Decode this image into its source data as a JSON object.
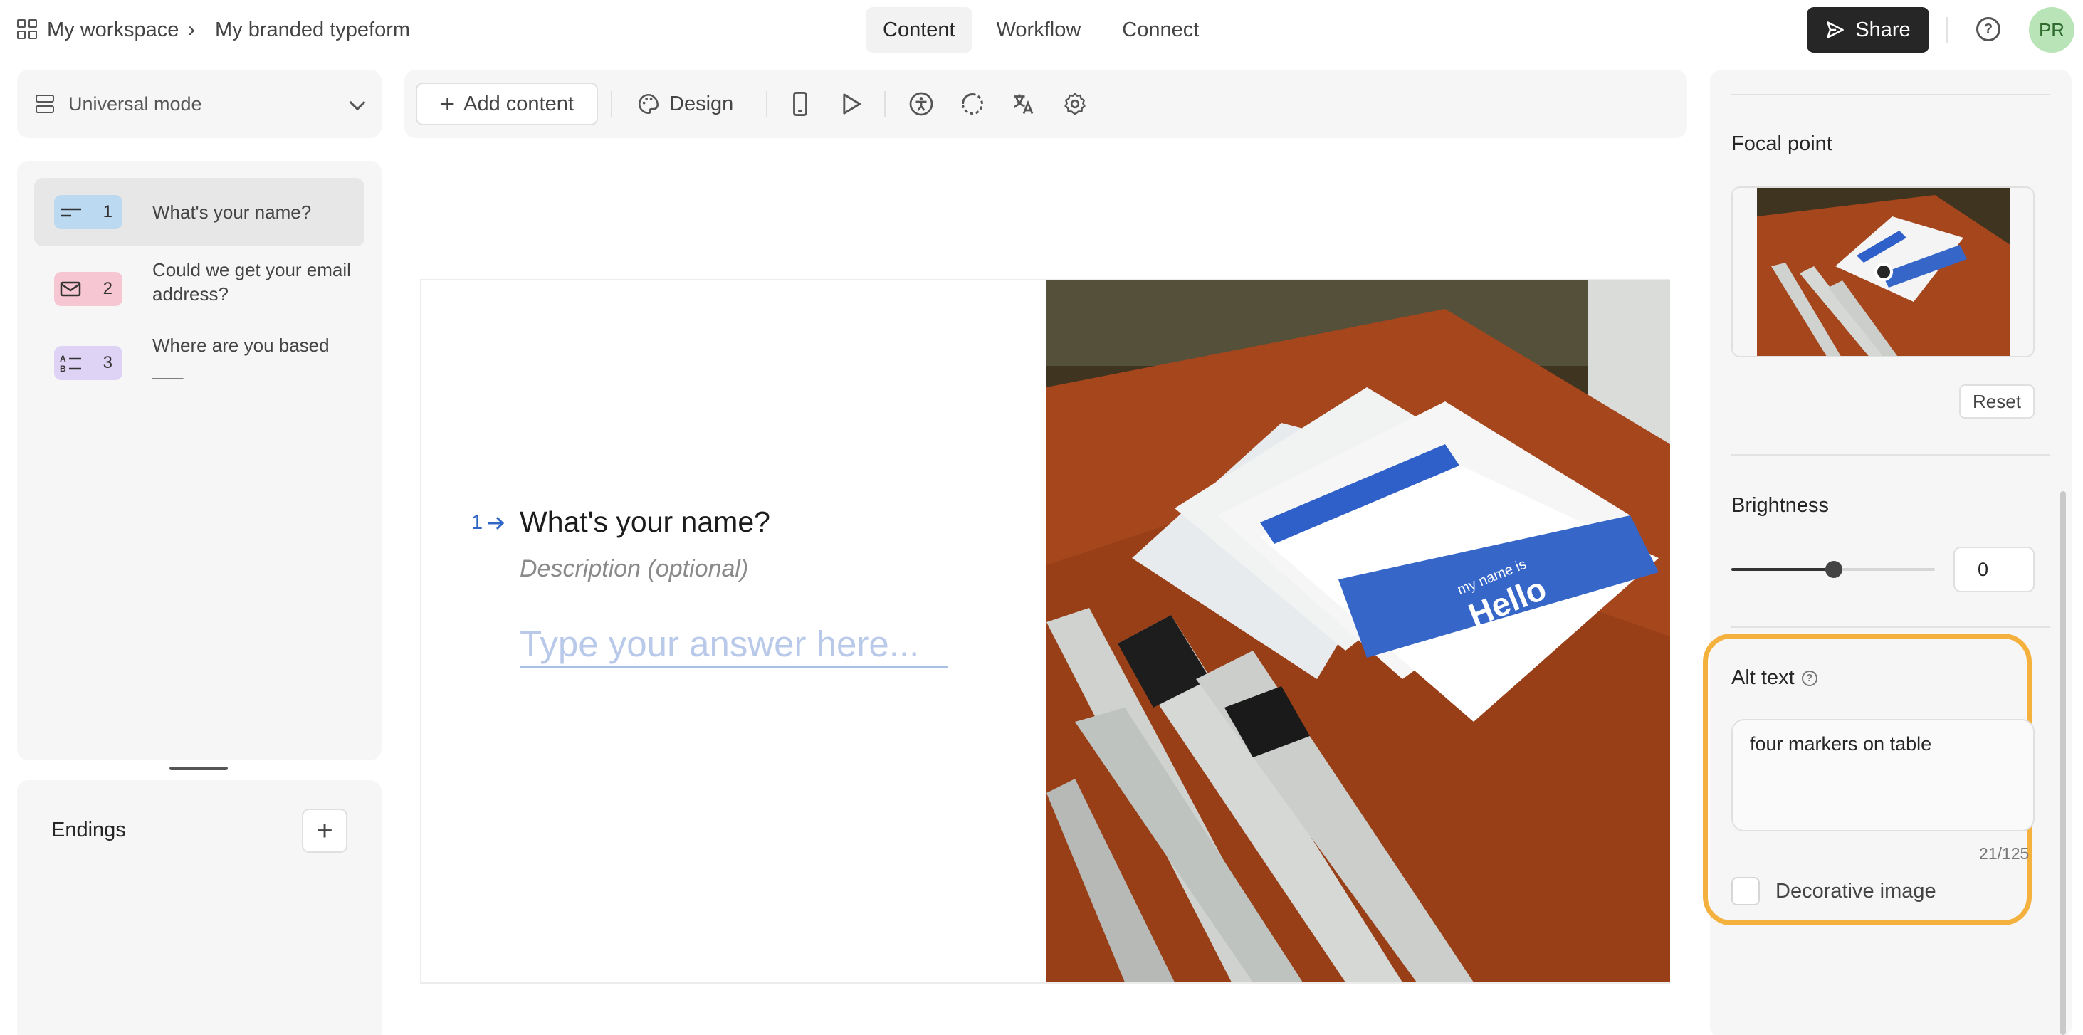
{
  "header": {
    "breadcrumb_workspace": "My workspace",
    "breadcrumb_separator": "›",
    "breadcrumb_form": "My branded typeform",
    "tabs": [
      {
        "label": "Content",
        "active": true
      },
      {
        "label": "Workflow",
        "active": false
      },
      {
        "label": "Connect",
        "active": false
      }
    ],
    "share_label": "Share",
    "help_icon": "help-circle-icon",
    "avatar_initials": "PR"
  },
  "sidebar": {
    "mode_label": "Universal mode",
    "questions": [
      {
        "number": "1",
        "text": "What's your name?",
        "icon": "short-text-icon",
        "badge_color": "#bcd9f2",
        "active": true
      },
      {
        "number": "2",
        "text": "Could we get your email address?",
        "icon": "email-icon",
        "badge_color": "#f6c6d3",
        "active": false
      },
      {
        "number": "3",
        "text": "Where are you based ___",
        "icon": "list-icon",
        "badge_color": "#ded3f5",
        "active": false
      }
    ],
    "endings_label": "Endings",
    "endings_add": "+"
  },
  "toolbar": {
    "add_content_label": "Add content",
    "design_label": "Design",
    "icons": [
      "mobile-preview-icon",
      "play-icon",
      "accessibility-icon",
      "loading-icon",
      "translate-icon",
      "settings-icon"
    ]
  },
  "canvas": {
    "question_number": "1",
    "question_title": "What's your name?",
    "description_placeholder": "Description (optional)",
    "answer_placeholder": "Type your answer here...",
    "image_subject": "photo-markers-and-name-tags",
    "name_tag_text": "Hello",
    "name_tag_subtext": "my name is"
  },
  "right_panel": {
    "focal_point_label": "Focal point",
    "reset_label": "Reset",
    "brightness_label": "Brightness",
    "brightness_value": "0",
    "brightness_fraction": 0.5,
    "alt_text_label": "Alt text",
    "alt_text_value": "four markers on table",
    "alt_text_counter": "21/125",
    "decorative_label": "Decorative image",
    "decorative_checked": false,
    "highlight_color": "#f5b13e"
  },
  "colors": {
    "accent_blue": "#3067c6",
    "dark_button": "#262627"
  }
}
